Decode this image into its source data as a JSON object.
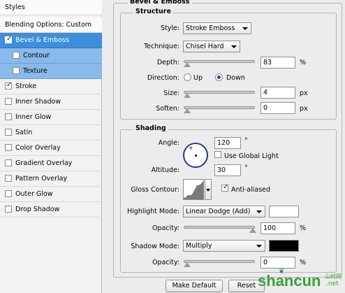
{
  "sidebar": {
    "header": "Styles",
    "blending": "Blending Options: Custom",
    "items": [
      {
        "label": "Bevel & Emboss",
        "checked": true
      },
      {
        "label": "Contour",
        "checked": false
      },
      {
        "label": "Texture",
        "checked": false
      },
      {
        "label": "Stroke",
        "checked": true
      },
      {
        "label": "Inner Shadow",
        "checked": false
      },
      {
        "label": "Inner Glow",
        "checked": false
      },
      {
        "label": "Satin",
        "checked": false
      },
      {
        "label": "Color Overlay",
        "checked": false
      },
      {
        "label": "Gradient Overlay",
        "checked": false
      },
      {
        "label": "Pattern Overlay",
        "checked": false
      },
      {
        "label": "Outer Glow",
        "checked": false
      },
      {
        "label": "Drop Shadow",
        "checked": false
      }
    ]
  },
  "bevel": {
    "title": "Bevel & Emboss",
    "structure": {
      "title": "Structure",
      "style_label": "Style:",
      "style_value": "Stroke Emboss",
      "technique_label": "Technique:",
      "technique_value": "Chisel Hard",
      "depth_label": "Depth:",
      "depth_value": "83",
      "depth_unit": "%",
      "direction_label": "Direction:",
      "direction_up": "Up",
      "direction_down": "Down",
      "size_label": "Size:",
      "size_value": "4",
      "size_unit": "px",
      "soften_label": "Soften:",
      "soften_value": "0",
      "soften_unit": "px"
    },
    "shading": {
      "title": "Shading",
      "angle_label": "Angle:",
      "angle_value": "120",
      "angle_unit": "°",
      "global_light_label": "Use Global Light",
      "altitude_label": "Altitude:",
      "altitude_value": "30",
      "altitude_unit": "°",
      "gloss_label": "Gloss Contour:",
      "antialiased_label": "Anti-aliased",
      "highlight_label": "Highlight Mode:",
      "highlight_value": "Linear Dodge (Add)",
      "highlight_color": "#ffffff",
      "highlight_opacity_label": "Opacity:",
      "highlight_opacity_value": "100",
      "highlight_opacity_unit": "%",
      "shadow_label": "Shadow Mode:",
      "shadow_value": "Multiply",
      "shadow_color": "#000000",
      "shadow_opacity_label": "Opacity:",
      "shadow_opacity_value": "0",
      "shadow_opacity_unit": "%"
    }
  },
  "buttons": {
    "make_default": "Make Default",
    "reset": "Reset"
  },
  "watermark": {
    "text": "shancun",
    "sub": "山村网",
    "net": ".net"
  }
}
